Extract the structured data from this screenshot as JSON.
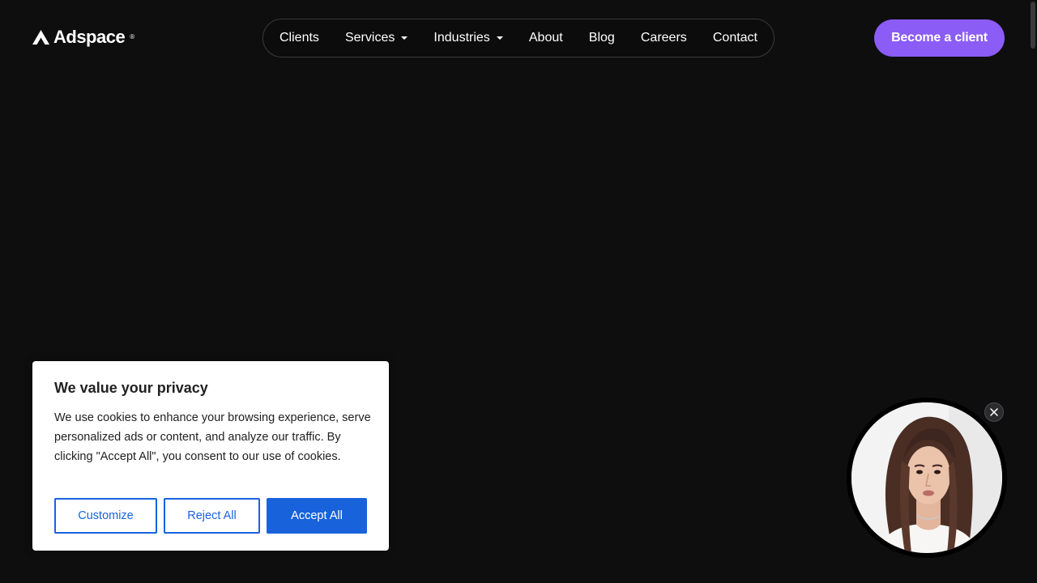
{
  "brand": {
    "name": "Adspace",
    "registered_mark": "®"
  },
  "nav": {
    "items": [
      {
        "label": "Clients",
        "dropdown": false
      },
      {
        "label": "Services",
        "dropdown": true
      },
      {
        "label": "Industries",
        "dropdown": true
      },
      {
        "label": "About",
        "dropdown": false
      },
      {
        "label": "Blog",
        "dropdown": false
      },
      {
        "label": "Careers",
        "dropdown": false
      },
      {
        "label": "Contact",
        "dropdown": false
      }
    ]
  },
  "cta": {
    "label": "Become a client"
  },
  "cookie_banner": {
    "title": "We value your privacy",
    "text": "We use cookies to enhance your browsing experience, serve personalized ads or content, and analyze our traffic. By clicking \"Accept All\", you consent to our use of cookies.",
    "buttons": {
      "customize": "Customize",
      "reject": "Reject All",
      "accept": "Accept All"
    }
  },
  "video_widget": {
    "icon": "close-icon"
  },
  "colors": {
    "background": "#0e0e0f",
    "accent": "#8b5cf6",
    "cookie_primary": "#1863dc"
  }
}
